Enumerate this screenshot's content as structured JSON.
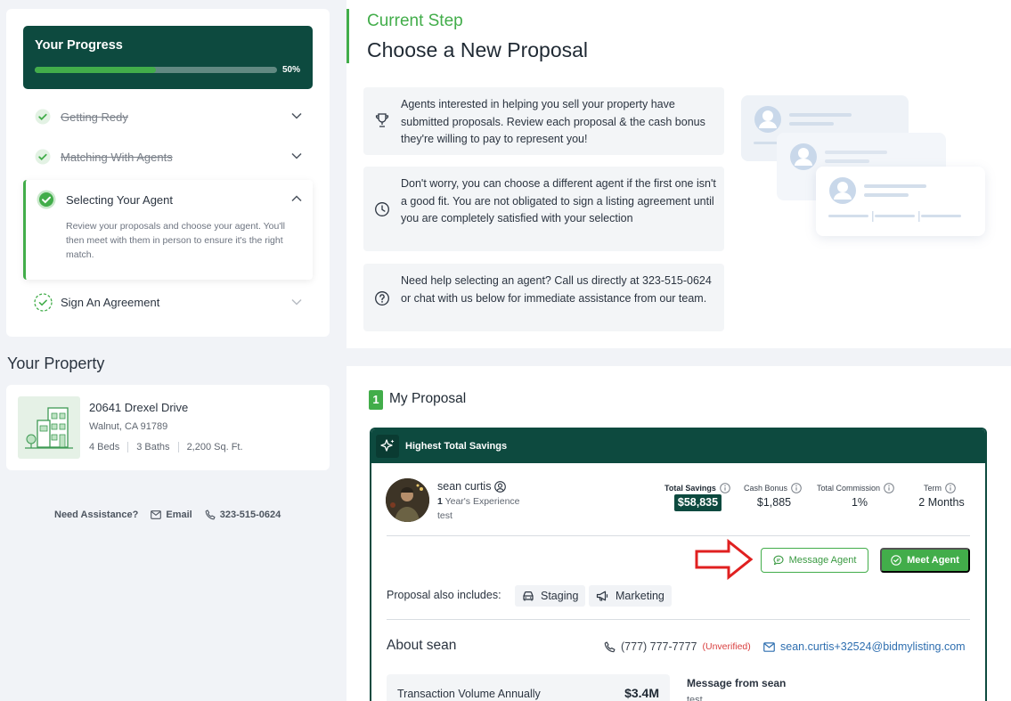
{
  "progress": {
    "title": "Your Progress",
    "percent_label": "50%",
    "percent_value": 50,
    "steps": [
      {
        "label": "Getting Redy",
        "status": "done"
      },
      {
        "label": "Matching With Agents",
        "status": "done"
      },
      {
        "label": "Selecting Your Agent",
        "status": "active",
        "description": "Review your proposals and choose your agent. You'll then meet with them in person to ensure it's the right match."
      },
      {
        "label": "Sign An Agreement",
        "status": "pending"
      }
    ]
  },
  "property": {
    "section_title": "Your Property",
    "address": "20641 Drexel Drive",
    "city": "Walnut, CA 91789",
    "beds": "4 Beds",
    "baths": "3 Baths",
    "sqft": "2,200 Sq. Ft."
  },
  "assistance": {
    "label": "Need Assistance?",
    "email_label": "Email",
    "phone": "323-515-0624"
  },
  "current_step": {
    "label": "Current Step",
    "title": "Choose a New Proposal",
    "info": [
      {
        "icon": "trophy-icon",
        "text": "Agents interested in helping you sell your property have submitted proposals. Review each proposal & the cash bonus they're willing to pay to represent you!"
      },
      {
        "icon": "clock-icon",
        "text": "Don't worry, you can choose a different agent if the first one isn't a good fit. You are not obligated to sign a listing agreement until you are completely satisfied with your selection"
      },
      {
        "icon": "question-icon",
        "text": "Need help selecting an agent? Call us directly at 323-515-0624 or chat with us below for immediate assistance from our team."
      }
    ]
  },
  "proposal": {
    "number": "1",
    "section_title": "My Proposal",
    "header_label": "Highest Total Savings",
    "agent": {
      "name": "sean curtis",
      "experience_num": "1",
      "experience_text": "Year's Experience",
      "note": "test"
    },
    "stats": {
      "total_savings_label": "Total Savings",
      "total_savings_value": "$58,835",
      "cash_bonus_label": "Cash Bonus",
      "cash_bonus_value": "$1,885",
      "commission_label": "Total Commission",
      "commission_value": "1%",
      "term_label": "Term",
      "term_value": "2 Months"
    },
    "buttons": {
      "message": "Message Agent",
      "meet": "Meet Agent"
    },
    "includes_label": "Proposal also includes:",
    "includes": [
      {
        "label": "Staging",
        "icon": "car-icon"
      },
      {
        "label": "Marketing",
        "icon": "megaphone-icon"
      }
    ],
    "about": {
      "title": "About sean",
      "phone": "(777) 777-7777",
      "phone_status": "(Unverified)",
      "email": "sean.curtis+32524@bidmylisting.com",
      "transaction_label": "Transaction Volume Annually",
      "transaction_value": "$3.4M",
      "message_title": "Message from sean",
      "message_body": "test"
    }
  },
  "colors": {
    "brand_dark": "#0d4a3f",
    "brand_green": "#42ad4a",
    "unverified_red": "#d94040",
    "link_blue": "#2f6fb0",
    "annotation_arrow": "#e02020"
  }
}
